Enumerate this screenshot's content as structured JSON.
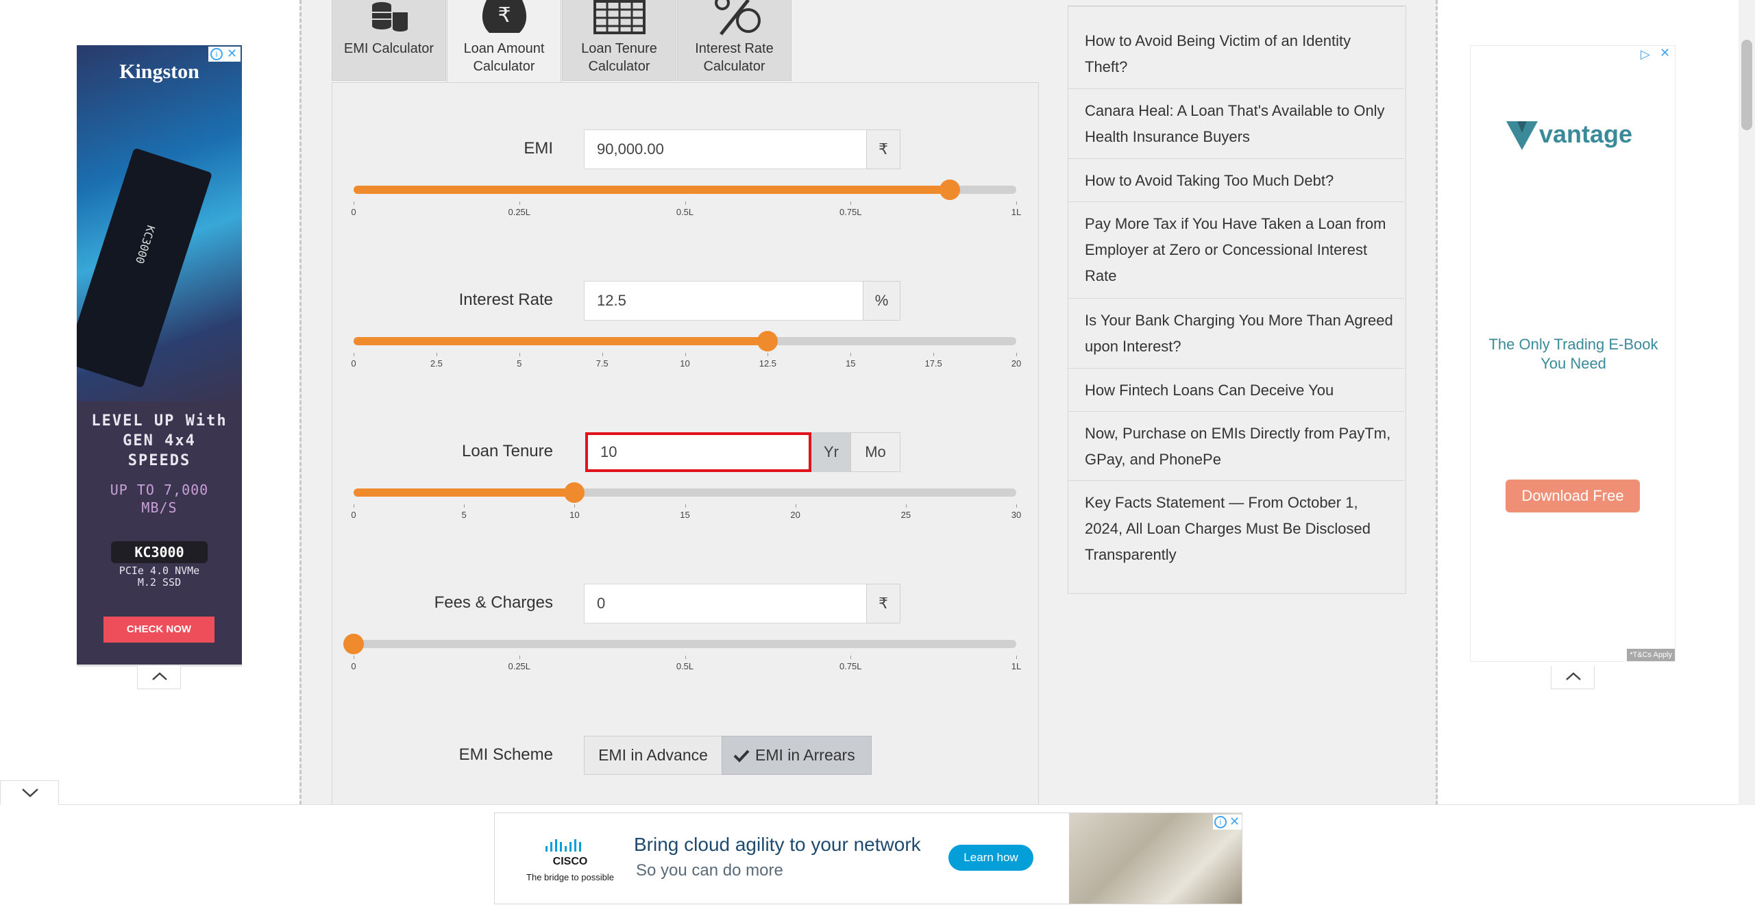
{
  "tabs": [
    {
      "label": "EMI Calculator",
      "icon": "stack-of-coins-icon"
    },
    {
      "label": "Loan Amount Calculator",
      "icon": "rupee-bag-icon"
    },
    {
      "label": "Loan Tenure Calculator",
      "icon": "calendar-grid-icon"
    },
    {
      "label": "Interest Rate Calculator",
      "icon": "percent-icon"
    }
  ],
  "emi": {
    "label": "EMI",
    "value": "90,000.00",
    "unit": "₹",
    "slider_fraction": 0.9,
    "ticks": [
      "0",
      "0.25L",
      "0.5L",
      "0.75L",
      "1L"
    ]
  },
  "interest": {
    "label": "Interest Rate",
    "value": "12.5",
    "unit": "%",
    "slider_fraction": 0.625,
    "ticks": [
      "0",
      "2.5",
      "5",
      "7.5",
      "10",
      "12.5",
      "15",
      "17.5",
      "20"
    ]
  },
  "tenure": {
    "label": "Loan Tenure",
    "value": "10",
    "unit_yr": "Yr",
    "unit_mo": "Mo",
    "slider_fraction": 0.3333,
    "ticks": [
      "0",
      "5",
      "10",
      "15",
      "20",
      "25",
      "30"
    ]
  },
  "fees": {
    "label": "Fees & Charges",
    "value": "0",
    "unit": "₹",
    "slider_fraction": 0,
    "ticks": [
      "0",
      "0.25L",
      "0.5L",
      "0.75L",
      "1L"
    ]
  },
  "scheme": {
    "label": "EMI Scheme",
    "advance": "EMI in Advance",
    "arrears": "EMI in Arrears"
  },
  "sidebar_links": [
    "How to Avoid Being Victim of an Identity Theft?",
    "Canara Heal: A Loan That's Available to Only Health Insurance Buyers",
    "How to Avoid Taking Too Much Debt?",
    "Pay More Tax if You Have Taken a Loan from Employer at Zero or Concessional Interest Rate",
    "Is Your Bank Charging You More Than Agreed upon Interest?",
    "How Fintech Loans Can Deceive You",
    "Now, Purchase on EMIs Directly from PayTm, GPay, and PhonePe",
    "Key Facts Statement — From October 1, 2024, All Loan Charges Must Be Disclosed Transparently"
  ],
  "ad_left": {
    "brand": "Kingston",
    "headline": "LEVEL UP With GEN 4x4 SPEEDS",
    "speed": "UP TO 7,000 MB/S",
    "model": "KC3000",
    "spec": "PCIe 4.0 NVMe M.2 SSD",
    "cta": "CHECK NOW",
    "chip_label": "KC3000"
  },
  "ad_right": {
    "brand": "vantage",
    "tagline": "The Only Trading E-Book You Need",
    "cta": "Download Free",
    "fine_print": "*T&Cs Apply"
  },
  "ad_bottom": {
    "brand": "CISCO",
    "brand_tag": "The bridge to possible",
    "headline": "Bring cloud agility to your network",
    "subline": "So you can do more",
    "cta": "Learn how"
  },
  "colors": {
    "accent": "#ef8b2c",
    "focus": "#e0131a",
    "cisco_blue": "#049fd9",
    "vantage_teal": "#3a8a9a"
  }
}
